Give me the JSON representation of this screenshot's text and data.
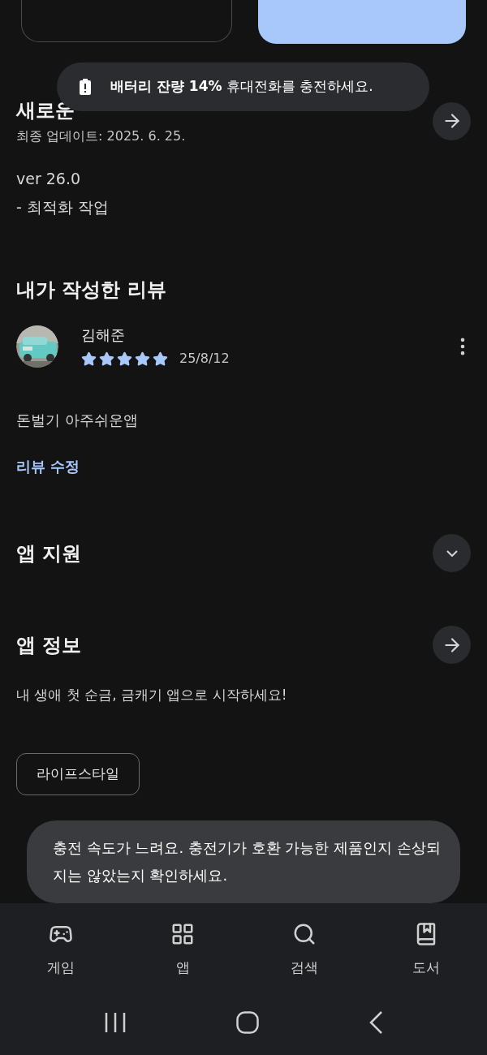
{
  "whats_new": {
    "title": "새로운",
    "updated": "최종 업데이트: 2025. 6. 25.",
    "lines": [
      "ver 26.0",
      "- 최적화 작업"
    ]
  },
  "my_review": {
    "title": "내가 작성한 리뷰",
    "author": "김해준",
    "stars": 5,
    "date": "25/8/12",
    "text": "돈벌기 아주쉬운앱",
    "edit_link": "리뷰 수정"
  },
  "app_support": {
    "title": "앱 지원",
    "expanded": false
  },
  "app_info": {
    "title": "앱 정보",
    "description": "내 생애 첫 순금, 금캐기 앱으로 시작하세요!",
    "category": "라이프스타일"
  },
  "toasts": [
    {
      "kind": "battery",
      "bold": "배터리 잔량 14%",
      "text": "휴대전화를 충전하세요."
    },
    {
      "kind": "plain",
      "text": "충전 속도가 느려요. 충전기가 호환 가능한 제품인지 손상되지는 않았는지 확인하세요."
    }
  ],
  "bottom_nav": [
    {
      "kind": "game",
      "label": "게임"
    },
    {
      "kind": "apps",
      "label": "앱"
    },
    {
      "kind": "search",
      "label": "검색"
    },
    {
      "kind": "book",
      "label": "도서"
    }
  ]
}
